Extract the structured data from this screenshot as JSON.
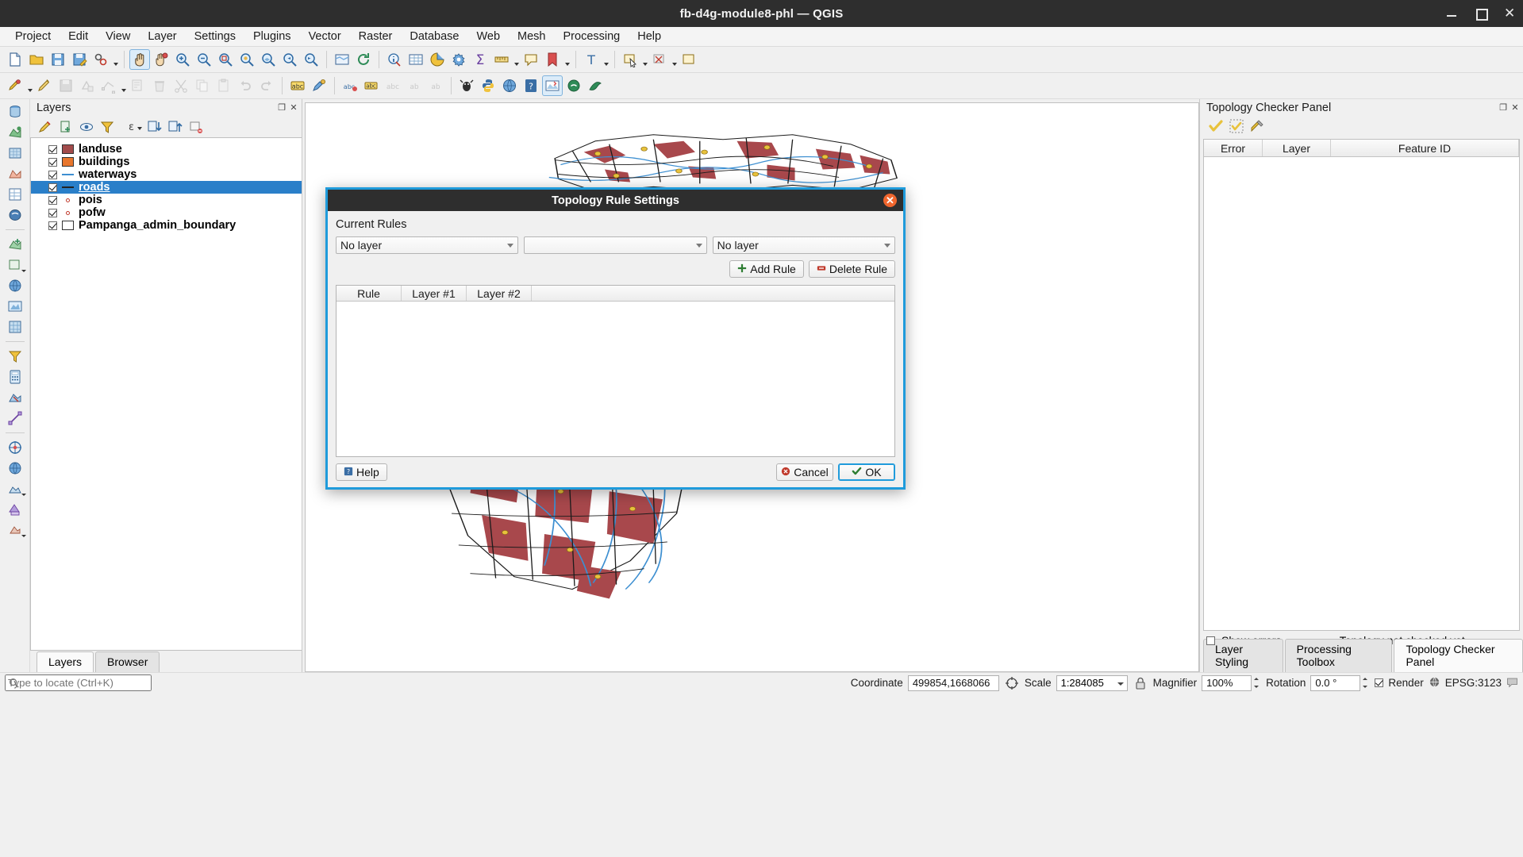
{
  "window": {
    "title": "fb-d4g-module8-phl — QGIS",
    "minimize": "minimize",
    "maximize": "maximize",
    "close": "close"
  },
  "menubar": [
    {
      "label": "Project"
    },
    {
      "label": "Edit"
    },
    {
      "label": "View"
    },
    {
      "label": "Layer"
    },
    {
      "label": "Settings"
    },
    {
      "label": "Plugins"
    },
    {
      "label": "Vector"
    },
    {
      "label": "Raster"
    },
    {
      "label": "Database"
    },
    {
      "label": "Web"
    },
    {
      "label": "Mesh"
    },
    {
      "label": "Processing"
    },
    {
      "label": "Help"
    }
  ],
  "layers_panel": {
    "title": "Layers",
    "items": [
      {
        "name": "landuse",
        "checked": true,
        "symbol": "polygon",
        "color": "#a24b4b"
      },
      {
        "name": "buildings",
        "checked": true,
        "symbol": "polygon",
        "color": "#e8762c"
      },
      {
        "name": "waterways",
        "checked": true,
        "symbol": "line",
        "color": "#3d8fd1"
      },
      {
        "name": "roads",
        "checked": true,
        "symbol": "line",
        "color": "#222222",
        "selected": true
      },
      {
        "name": "pois",
        "checked": true,
        "symbol": "point",
        "color": "#c0392b"
      },
      {
        "name": "pofw",
        "checked": true,
        "symbol": "point",
        "color": "#c0392b"
      },
      {
        "name": "Pampanga_admin_boundary",
        "checked": true,
        "symbol": "polygon",
        "color": "#ffffff"
      }
    ],
    "tabs": [
      {
        "label": "Layers",
        "active": true
      },
      {
        "label": "Browser",
        "active": false
      }
    ]
  },
  "locate": {
    "placeholder": "Type to locate (Ctrl+K)",
    "value": ""
  },
  "topology_panel": {
    "title": "Topology Checker Panel",
    "columns": [
      "Error",
      "Layer",
      "Feature ID"
    ],
    "rows": [],
    "show_errors_label": "Show errors",
    "show_errors_checked": false,
    "status": "Topology not checked yet",
    "tabs": [
      {
        "label": "Layer Styling",
        "active": false
      },
      {
        "label": "Processing Toolbox",
        "active": false
      },
      {
        "label": "Topology Checker Panel",
        "active": true
      }
    ]
  },
  "dialog": {
    "title": "Topology Rule Settings",
    "section_label": "Current Rules",
    "combo_layer1": "No layer",
    "combo_rule": "",
    "combo_layer2": "No layer",
    "add_rule_label": "Add Rule",
    "delete_rule_label": "Delete Rule",
    "columns": [
      "Rule",
      "Layer #1",
      "Layer #2"
    ],
    "rows": [],
    "help_label": "Help",
    "cancel_label": "Cancel",
    "ok_label": "OK"
  },
  "statusbar": {
    "coordinate_label": "Coordinate",
    "coordinate_value": "499854,1668066",
    "scale_label": "Scale",
    "scale_value": "1:284085",
    "magnifier_label": "Magnifier",
    "magnifier_value": "100%",
    "rotation_label": "Rotation",
    "rotation_value": "0.0 °",
    "render_label": "Render",
    "render_checked": true,
    "crs_value": "EPSG:3123"
  },
  "colors": {
    "accent": "#1f9bdb",
    "selection": "#2a7fc9",
    "titlebar": "#2e2e2e",
    "close_button": "#f0662e"
  }
}
